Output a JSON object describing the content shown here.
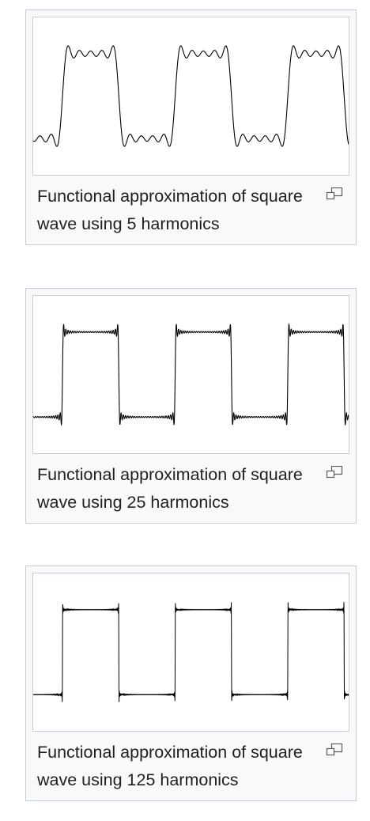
{
  "figures": [
    {
      "caption": "Functional approximation of square wave using 5 harmonics",
      "harmonics": 5
    },
    {
      "caption": "Functional approximation of square wave using 25 harmonics",
      "harmonics": 25
    },
    {
      "caption": "Functional approximation of square wave using 125 harmonics",
      "harmonics": 125
    }
  ],
  "icons": {
    "magnify": "magnify-icon"
  },
  "colors": {
    "frame_background": "#f8f9fa",
    "frame_border": "#c8ccd1",
    "text": "#202122",
    "curve": "#000000"
  }
}
